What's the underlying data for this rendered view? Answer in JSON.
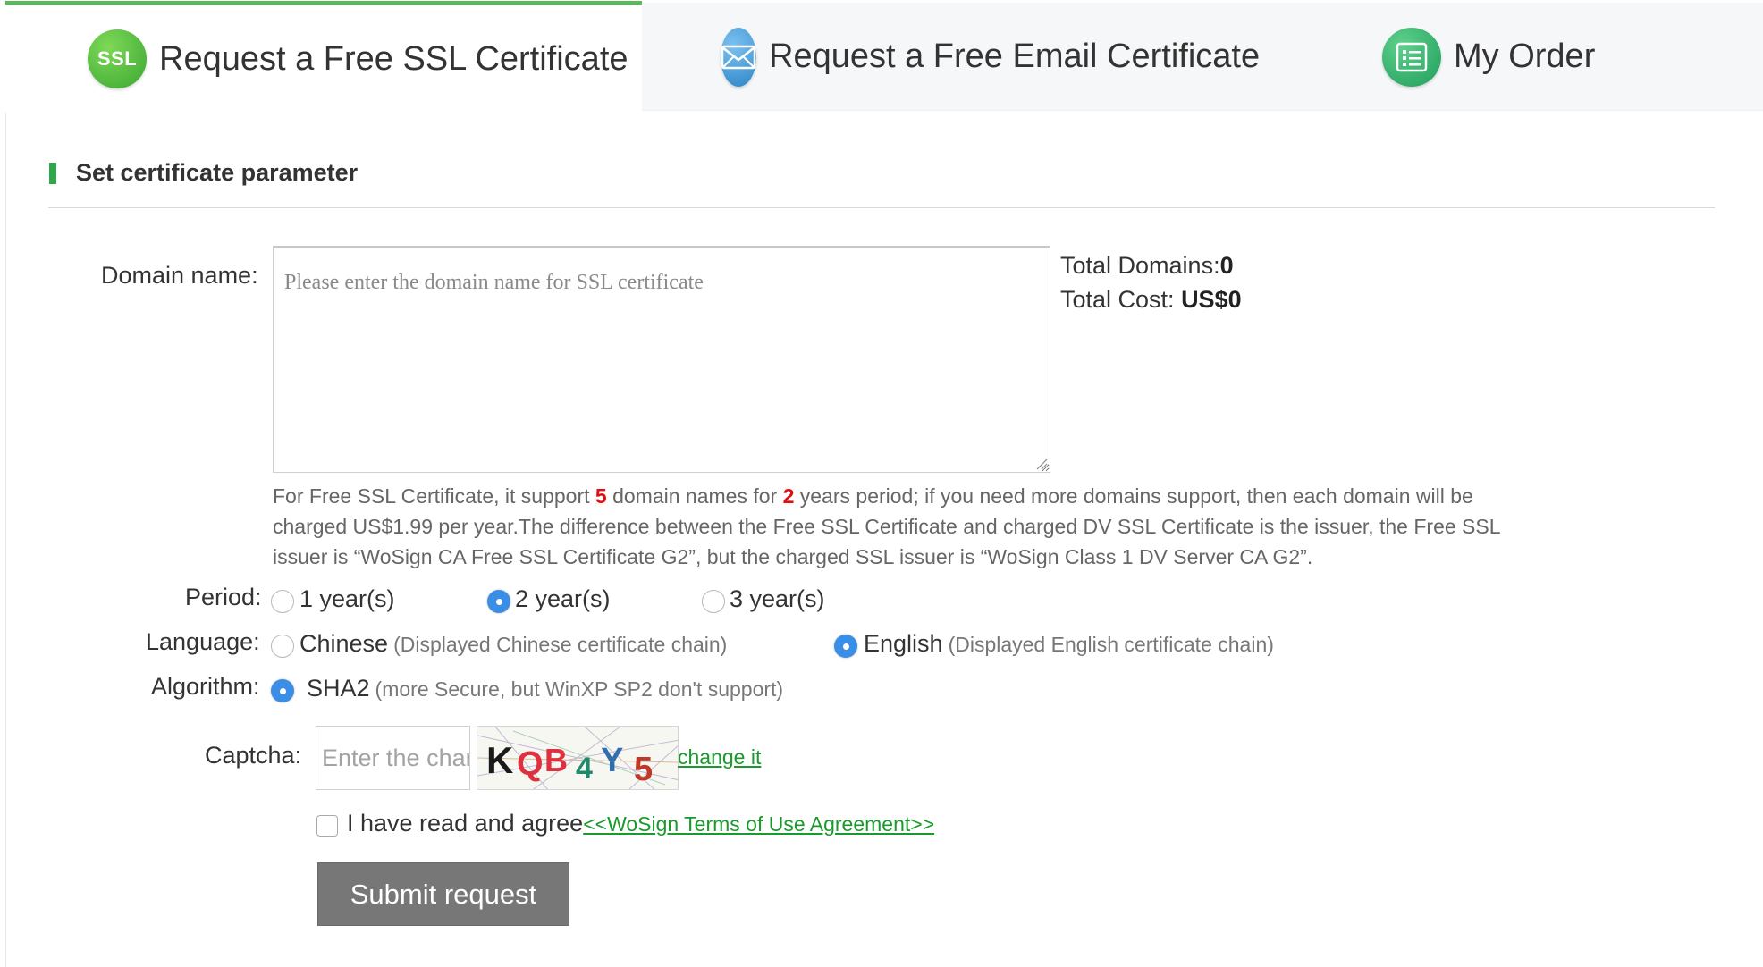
{
  "tabs": [
    {
      "label": "Request a Free SSL Certificate",
      "icon": "ssl-icon",
      "icon_text": "SSL",
      "active": true
    },
    {
      "label": "Request a Free Email Certificate",
      "icon": "mail-icon",
      "active": false
    },
    {
      "label": "My Order",
      "icon": "order-list-icon",
      "active": false
    }
  ],
  "section": {
    "title": "Set certificate parameter"
  },
  "domain": {
    "label": "Domain name:",
    "placeholder": "Please enter the domain name for SSL certificate",
    "value": ""
  },
  "totals": {
    "domains_label": "Total Domains:",
    "domains_value": "0",
    "cost_label": "Total Cost: ",
    "cost_value": "US$0"
  },
  "note": {
    "part1": "For Free SSL Certificate, it support ",
    "num_domains": "5",
    "part2": " domain names for ",
    "num_years": "2",
    "part3": " years period; if you need more domains support, then each domain will be charged US$1.99 per year.The difference between the Free SSL Certificate and charged DV SSL Certificate is the issuer, the Free SSL issuer is “WoSign CA Free SSL Certificate G2”, but the charged SSL issuer is “WoSign Class 1 DV Server CA G2”."
  },
  "period": {
    "label": "Period:",
    "options": [
      "1 year(s)",
      "2 year(s)",
      "3 year(s)"
    ],
    "selected": "2 year(s)"
  },
  "language": {
    "label": "Language:",
    "options": [
      {
        "name": "Chinese",
        "hint": "(Displayed Chinese certificate chain)"
      },
      {
        "name": "English",
        "hint": "(Displayed English certificate chain)"
      }
    ],
    "selected": "English"
  },
  "algorithm": {
    "label": "Algorithm:",
    "name": "SHA2",
    "hint": "(more Secure, but WinXP SP2 don't support)",
    "selected": true
  },
  "captcha": {
    "label": "Captcha:",
    "placeholder": "Enter the characters",
    "image_text": [
      "K",
      "Q",
      "B",
      "4",
      "Y",
      "5"
    ],
    "change_link": "change it"
  },
  "agreement": {
    "text": "I have read and agree",
    "link": "<<WoSign Terms of Use Agreement>>",
    "checked": false
  },
  "submit": {
    "label": "Submit request"
  },
  "colors": {
    "accent_green": "#5cb85c",
    "section_bar": "#2ea64b",
    "radio_selected": "#3a8ee6",
    "link": "#1a9a2c",
    "highlight_red": "#e01010",
    "submit_bg": "#777777"
  }
}
